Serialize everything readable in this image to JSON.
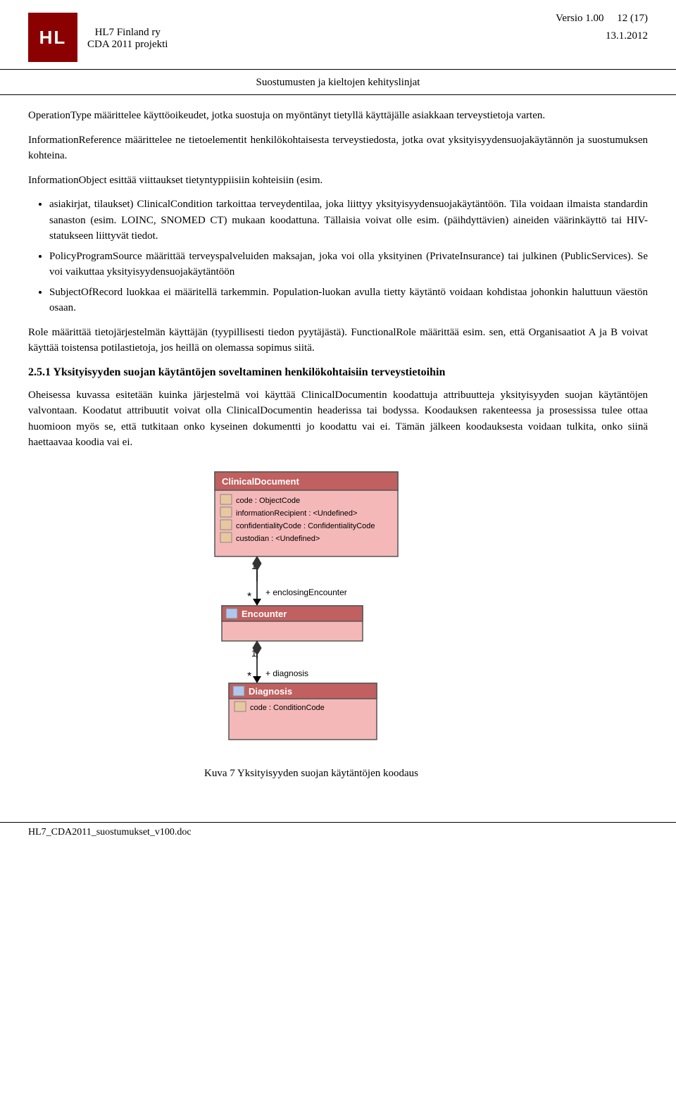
{
  "header": {
    "org_line1": "HL7 Finland ry",
    "org_line2": "CDA 2011 projekti",
    "version_label": "Versio 1.00",
    "page_info": "12 (17)",
    "date": "13.1.2012",
    "logo_text": "HL"
  },
  "subtitle": "Suostumusten ja kieltojen kehityslinjat",
  "paragraphs": {
    "p1": "OperationType määrittelee käyttöoikeudet, jotka suostuja on myöntänyt tietyllä käyttäjälle asiakkaan terveystietoja varten.",
    "p2": "InformationReference määrittelee ne tietoelementit henkilökohtaisesta terveystiedosta, jotka ovat yksityisyydensuojakäytännön ja suostumuksen kohteina.",
    "p3": "InformationObject esittää viittaukset tietyntyppiisiin kohteisiin (esim.",
    "bullet1": "asiakirjat, tilaukset) ClinicalCondition tarkoittaa terveydentilaa, joka liittyy yksityisyydensuojakäytäntöön. Tila voidaan ilmaista standardin sanaston (esim. LOINC, SNOMED CT) mukaan koodattuna. Tällaisia voivat olle esim. (päihdyttävien) aineiden väärinkäyttö tai HIV-statukseen liittyvät tiedot.",
    "bullet2": "PolicyProgramSource määrittää terveyspalveluiden maksajan, joka voi olla yksityinen (PrivateInsurance) tai julkinen (PublicServices). Se voi vaikuttaa yksityisyydensuojakäytäntöön",
    "bullet3": "SubjectOfRecord luokkaa ei määritellä tarkemmin. Population-luokan avulla tietty käytäntö voidaan kohdistaa johonkin haluttuun väestön osaan.",
    "p4": "Role määrittää tietojärjestelmän käyttäjän (tyypillisesti tiedon pyytäjästä). FunctionalRole määrittää esim. sen, että Organisaatiot A ja B voivat käyttää toistensa potilastietoja, jos heillä on olemassa sopimus siitä.",
    "section_heading": "2.5.1  Yksityisyyden suojan käytäntöjen soveltaminen henkilökohtaisiin terveystietoihin",
    "p5": "Oheisessa kuvassa esitetään kuinka järjestelmä voi käyttää ClinicalDocumentin koodattuja attribuutteja yksityisyyden suojan käytäntöjen valvontaan. Koodatut attribuutit voivat olla ClinicalDocumentin headerissa tai bodyssa. Koodauksen rakenteessa ja prosessissa tulee ottaa huomioon myös se, että tutkitaan onko kyseinen dokumentti jo koodattu vai ei. Tämän jälkeen koodauksesta voidaan tulkita, onko siinä haettaavaa koodia vai ei."
  },
  "diagram": {
    "clinical_document_label": "ClinicalDocument",
    "attr1": "code : ObjectCode",
    "attr2": "informationRecipient : <Undefined>",
    "attr3": "confidentialityCode : ConfidentialityCode",
    "attr4": "custodian : <Undefined>",
    "one_label1": "1",
    "star_label1": "*",
    "enclosing_label": "+ enclosingEncounter",
    "encounter_label": "Encounter",
    "one_label2": "1",
    "star_label2": "*",
    "diagnosis_rel_label": "+ diagnosis",
    "diagnosis_label": "Diagnosis",
    "diagnosis_attr": "code : ConditionCode"
  },
  "figure_caption": "Kuva 7 Yksityisyyden suojan käytäntöjen koodaus",
  "footer": {
    "filename": "HL7_CDA2011_suostumukset_v100.doc"
  }
}
